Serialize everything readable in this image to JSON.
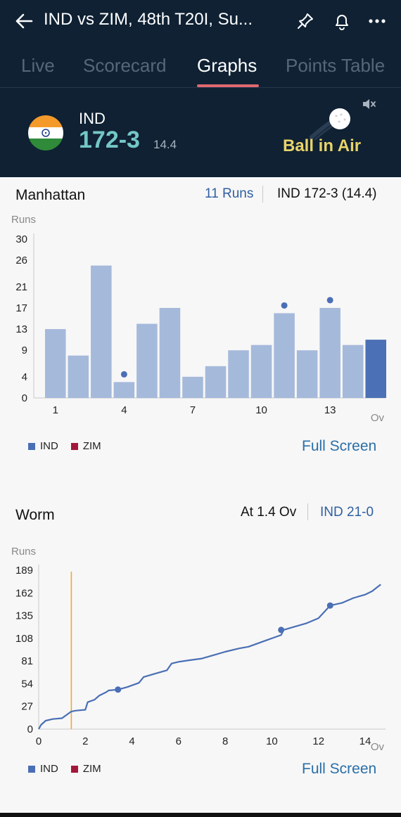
{
  "header": {
    "title": "IND vs ZIM, 48th T20I, Su...",
    "tabs": [
      "Live",
      "Scorecard",
      "Graphs",
      "Points Table"
    ],
    "active_tab": "Graphs"
  },
  "score": {
    "team": "IND",
    "runs_wickets": "172-3",
    "overs": "14.4",
    "status": "Ball in Air"
  },
  "manhattan": {
    "title": "Manhattan",
    "selected_runs": "11 Runs",
    "selected_score": "IND 172-3 (14.4)",
    "legend": [
      "IND",
      "ZIM"
    ],
    "full_screen": "Full Screen"
  },
  "worm": {
    "title": "Worm",
    "selected_over": "At 1.4 Ov",
    "selected_score": "IND 21-0",
    "legend": [
      "IND",
      "ZIM"
    ],
    "full_screen": "Full Screen"
  },
  "colors": {
    "header_bg": "#0f2133",
    "ind": "#4a6fb5",
    "zim": "#a3183a",
    "bar": "#a5b9db",
    "bar_selected": "#4b70b5",
    "accent_link": "#2a6fa8",
    "score_teal": "#74c7c6",
    "tab_underline": "#e0696f",
    "cursor_line": "#f0a830"
  },
  "chart_data": [
    {
      "type": "bar",
      "name": "Manhattan",
      "ylabel": "Runs",
      "xlabel": "Ov",
      "yticks": [
        0,
        4,
        9,
        13,
        17,
        21,
        26,
        30
      ],
      "xticks": [
        1,
        4,
        7,
        10,
        13
      ],
      "ylim": [
        0,
        30
      ],
      "categories": [
        1,
        2,
        3,
        4,
        5,
        6,
        7,
        8,
        9,
        10,
        11,
        12,
        13,
        14,
        15
      ],
      "series": [
        {
          "name": "IND",
          "values": [
            13,
            8,
            25,
            3,
            14,
            17,
            4,
            6,
            9,
            10,
            16,
            9,
            17,
            10,
            11
          ]
        }
      ],
      "wickets_in_overs": [
        4,
        11,
        13
      ],
      "selected_over": 15
    },
    {
      "type": "line",
      "name": "Worm",
      "ylabel": "Runs",
      "xlabel": "Ov",
      "yticks": [
        0,
        27,
        54,
        81,
        108,
        135,
        162,
        189
      ],
      "xticks": [
        0,
        2,
        4,
        6,
        8,
        10,
        12,
        14
      ],
      "ylim": [
        0,
        189
      ],
      "xlim": [
        0,
        14.67
      ],
      "series": [
        {
          "name": "IND",
          "x": [
            0,
            0.1,
            0.3,
            0.6,
            1.0,
            1.4,
            1.6,
            2.0,
            2.1,
            2.4,
            2.6,
            2.9,
            3.0,
            3.4,
            3.8,
            4.3,
            4.5,
            5.0,
            5.5,
            5.7,
            6.0,
            6.5,
            7.0,
            7.5,
            8.0,
            8.6,
            9.0,
            9.5,
            10.0,
            10.4,
            10.5,
            11.0,
            11.5,
            12.0,
            12.5,
            13.0,
            13.5,
            14.0,
            14.3,
            14.67
          ],
          "y": [
            0,
            5,
            10,
            12,
            13,
            21,
            22,
            23,
            32,
            35,
            40,
            44,
            46,
            47,
            50,
            55,
            62,
            66,
            70,
            78,
            80,
            82,
            84,
            88,
            92,
            96,
            98,
            103,
            108,
            112,
            118,
            122,
            126,
            132,
            147,
            150,
            156,
            160,
            164,
            172
          ]
        }
      ],
      "wicket_points": [
        {
          "x": 3.4,
          "y": 47
        },
        {
          "x": 10.4,
          "y": 118
        },
        {
          "x": 12.5,
          "y": 147
        }
      ],
      "cursor_over": 1.4
    }
  ]
}
